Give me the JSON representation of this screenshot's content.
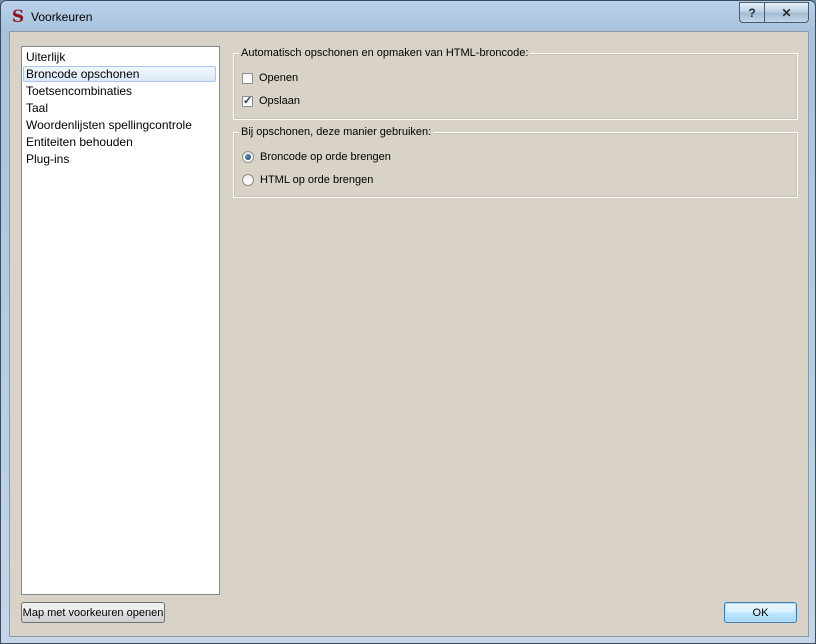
{
  "window": {
    "title": "Voorkeuren",
    "app_icon": "S"
  },
  "caption": {
    "help": "?",
    "close": "✕"
  },
  "nav": {
    "items": [
      {
        "label": "Uiterlijk",
        "selected": false
      },
      {
        "label": "Broncode opschonen",
        "selected": true
      },
      {
        "label": "Toetsencombinaties",
        "selected": false
      },
      {
        "label": "Taal",
        "selected": false
      },
      {
        "label": "Woordenlijsten spellingcontrole",
        "selected": false
      },
      {
        "label": "Entiteiten behouden",
        "selected": false
      },
      {
        "label": "Plug-ins",
        "selected": false
      }
    ]
  },
  "auto_clean": {
    "legend": "Automatisch opschonen en opmaken van HTML-broncode:",
    "open_label": "Openen",
    "open_checked": false,
    "save_label": "Opslaan",
    "save_checked": true
  },
  "clean_method": {
    "legend": "Bij opschonen, deze manier gebruiken:",
    "options": [
      {
        "label": "Broncode op orde brengen",
        "selected": true
      },
      {
        "label": "HTML op orde brengen",
        "selected": false
      }
    ]
  },
  "buttons": {
    "open_folder": "Map met voorkeuren openen",
    "ok": "OK"
  },
  "colors": {
    "dialog_bg": "#d8d3c6",
    "accent": "#3c7fb1"
  }
}
